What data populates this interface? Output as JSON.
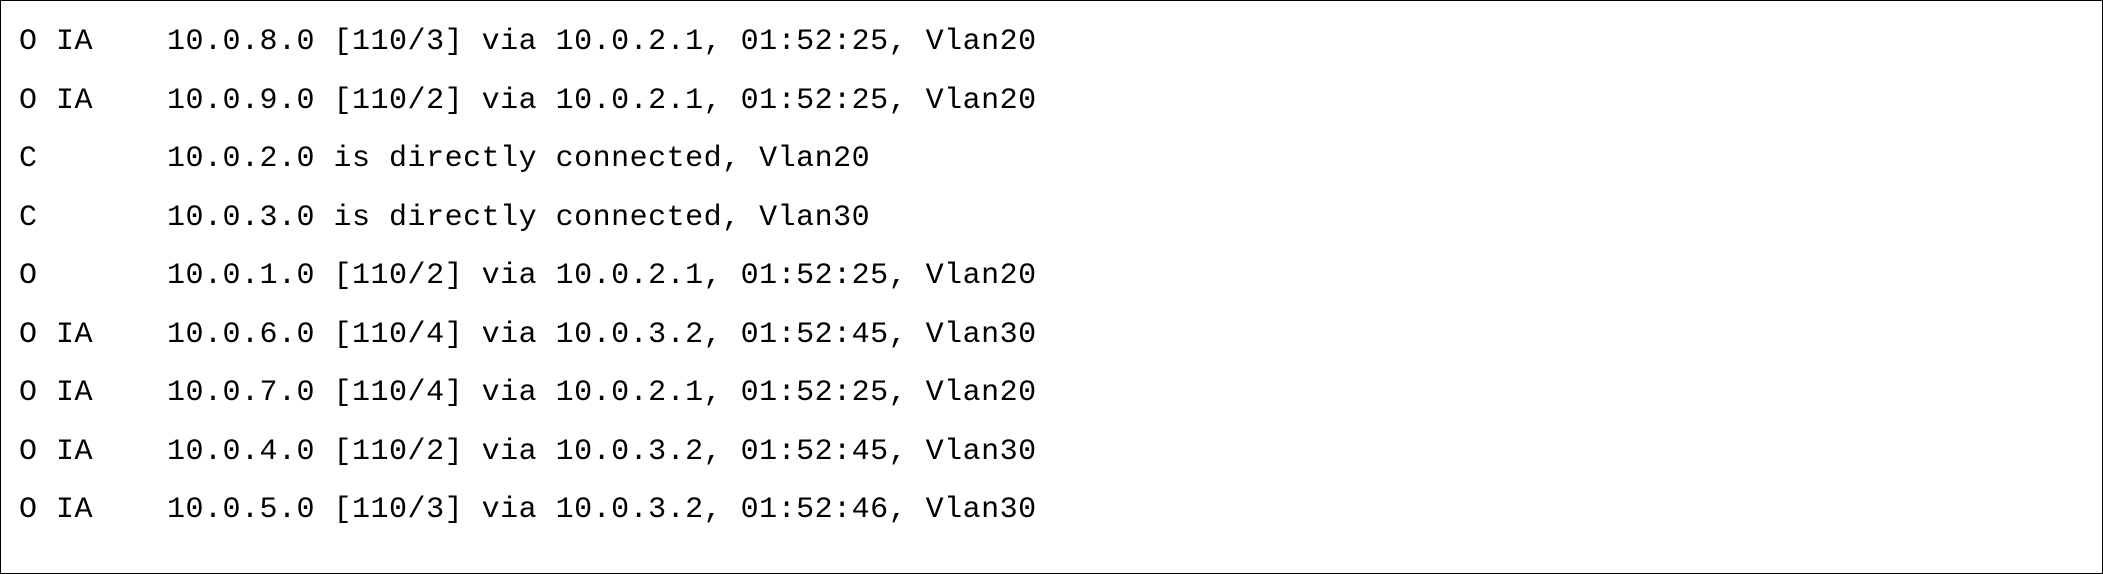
{
  "routes": [
    {
      "code": "O IA",
      "network": "10.0.8.0",
      "metric": "[110/3]",
      "via_keyword": "via",
      "next_hop": "10.0.2.1,",
      "uptime": "01:52:25,",
      "interface": "Vlan20"
    },
    {
      "code": "O IA",
      "network": "10.0.9.0",
      "metric": "[110/2]",
      "via_keyword": "via",
      "next_hop": "10.0.2.1,",
      "uptime": "01:52:25,",
      "interface": "Vlan20"
    },
    {
      "code": "C",
      "network": "10.0.2.0",
      "connected_text": "is directly connected,",
      "interface": "Vlan20"
    },
    {
      "code": "C",
      "network": "10.0.3.0",
      "connected_text": "is directly connected,",
      "interface": "Vlan30"
    },
    {
      "code": "O",
      "network": "10.0.1.0",
      "metric": "[110/2]",
      "via_keyword": "via",
      "next_hop": "10.0.2.1,",
      "uptime": "01:52:25,",
      "interface": "Vlan20"
    },
    {
      "code": "O IA",
      "network": "10.0.6.0",
      "metric": "[110/4]",
      "via_keyword": "via",
      "next_hop": "10.0.3.2,",
      "uptime": "01:52:45,",
      "interface": "Vlan30"
    },
    {
      "code": "O IA",
      "network": "10.0.7.0",
      "metric": "[110/4]",
      "via_keyword": "via",
      "next_hop": "10.0.2.1,",
      "uptime": "01:52:25,",
      "interface": "Vlan20"
    },
    {
      "code": "O IA",
      "network": "10.0.4.0",
      "metric": "[110/2]",
      "via_keyword": "via",
      "next_hop": "10.0.3.2,",
      "uptime": "01:52:45,",
      "interface": "Vlan30"
    },
    {
      "code": "O IA",
      "network": "10.0.5.0",
      "metric": "[110/3]",
      "via_keyword": "via",
      "next_hop": "10.0.3.2,",
      "uptime": "01:52:46,",
      "interface": "Vlan30"
    }
  ],
  "lines": {
    "l0": "O IA    10.0.8.0 [110/3] via 10.0.2.1, 01:52:25, Vlan20",
    "l1": "O IA    10.0.9.0 [110/2] via 10.0.2.1, 01:52:25, Vlan20",
    "l2": "C       10.0.2.0 is directly connected, Vlan20",
    "l3": "C       10.0.3.0 is directly connected, Vlan30",
    "l4": "O       10.0.1.0 [110/2] via 10.0.2.1, 01:52:25, Vlan20",
    "l5": "O IA    10.0.6.0 [110/4] via 10.0.3.2, 01:52:45, Vlan30",
    "l6": "O IA    10.0.7.0 [110/4] via 10.0.2.1, 01:52:25, Vlan20",
    "l7": "O IA    10.0.4.0 [110/2] via 10.0.3.2, 01:52:45, Vlan30",
    "l8": "O IA    10.0.5.0 [110/3] via 10.0.3.2, 01:52:46, Vlan30"
  }
}
